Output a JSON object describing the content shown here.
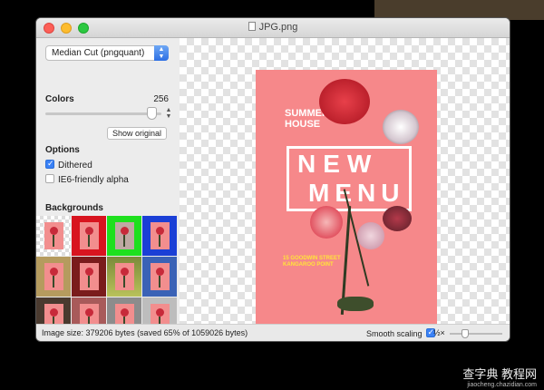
{
  "window": {
    "title": "JPG.png"
  },
  "sidebar": {
    "quantizer": "Median Cut (pngquant)",
    "colors_label": "Colors",
    "colors_value": "256",
    "colors_slider_fraction": 0.92,
    "show_original_label": "Show original",
    "options_label": "Options",
    "dithered_label": "Dithered",
    "dithered_checked": true,
    "ie6_label": "IE6-friendly alpha",
    "ie6_checked": false,
    "backgrounds_label": "Backgrounds",
    "backgrounds": [
      "checker-light",
      "red",
      "green",
      "blue",
      "noise-warm",
      "dark-red",
      "gradient-green",
      "blue-pattern",
      "noise-dark",
      "red-pattern",
      "gray-pattern",
      "gray"
    ]
  },
  "poster": {
    "summer_house": "SUMMER HOUSE",
    "new_text": "NEW",
    "menu_text": "MENU",
    "address": "15 GOODWIN STREET KANGAROO POINT"
  },
  "status": {
    "image_size": "Image size: 379206 bytes (saved 65% of 1059026 bytes)",
    "smooth_label": "Smooth scaling",
    "smooth_checked": true,
    "zoom_label": "½×"
  },
  "watermark": {
    "main": "查字典 教程网",
    "sub": "jiaocheng.chazidian.com"
  },
  "colors": {
    "accent": "#3b82f6",
    "poster": "#f6888a"
  }
}
